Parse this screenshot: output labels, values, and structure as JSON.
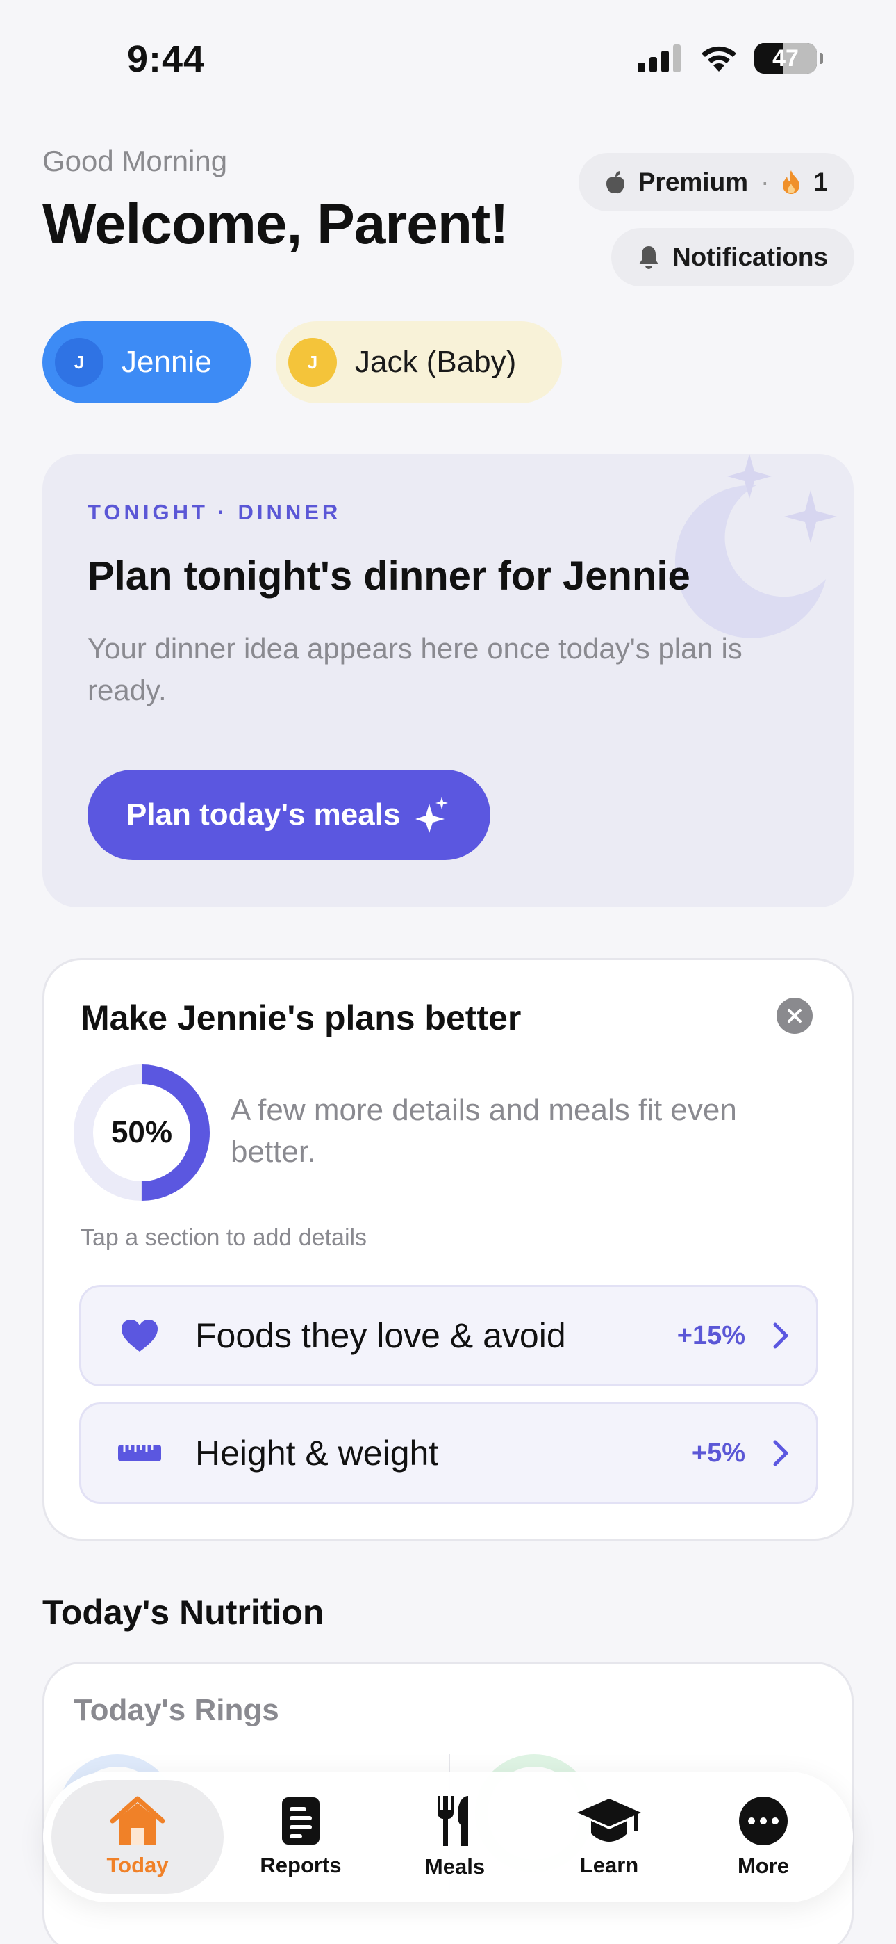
{
  "status": {
    "time": "9:44",
    "battery": "47"
  },
  "header": {
    "greeting": "Good Morning",
    "welcome": "Welcome, Parent!",
    "premium_label": "Premium",
    "streak_count": "1",
    "notifications_label": "Notifications"
  },
  "profiles": [
    {
      "initial": "J",
      "name": "Jennie",
      "selected": true
    },
    {
      "initial": "J",
      "name": "Jack (Baby)",
      "selected": false
    }
  ],
  "dinner_card": {
    "tag": "TONIGHT · DINNER",
    "title": "Plan tonight's dinner for Jennie",
    "description": "Your dinner idea appears here once today's plan is ready.",
    "button_label": "Plan today's meals"
  },
  "improve_card": {
    "title": "Make Jennie's plans better",
    "progress_label": "50%",
    "progress_fraction": 0.5,
    "description": "A few more details and meals fit even better.",
    "hint": "Tap a section to add details",
    "rows": [
      {
        "label": "Foods they love & avoid",
        "pct": "+15%",
        "icon": "heart-icon"
      },
      {
        "label": "Height & weight",
        "pct": "+5%",
        "icon": "ruler-icon"
      }
    ]
  },
  "nutrition": {
    "heading": "Today's Nutrition",
    "rings_title": "Today's Rings"
  },
  "tabs": [
    {
      "label": "Today",
      "icon": "house-icon",
      "active": true
    },
    {
      "label": "Reports",
      "icon": "document-icon",
      "active": false
    },
    {
      "label": "Meals",
      "icon": "fork-knife-icon",
      "active": false
    },
    {
      "label": "Learn",
      "icon": "graduation-cap-icon",
      "active": false
    },
    {
      "label": "More",
      "icon": "ellipsis-icon",
      "active": false
    }
  ],
  "colors": {
    "accent": "#5b57e0",
    "selected_profile": "#3d8bf5",
    "active_tab": "#f08128",
    "background": "#f6f6f9"
  }
}
